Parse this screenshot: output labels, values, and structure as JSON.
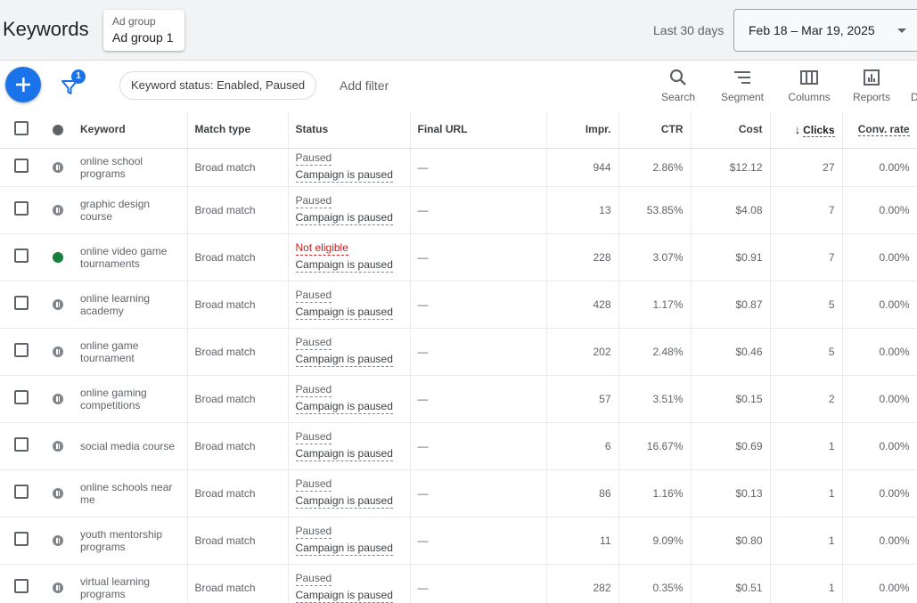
{
  "header": {
    "title": "Keywords",
    "ad_group_label": "Ad group",
    "ad_group_value": "Ad group 1",
    "range_label": "Last 30 days",
    "date_range": "Feb 18 – Mar 19, 2025"
  },
  "toolbar": {
    "filter_badge": "1",
    "filter_chip": "Keyword status: Enabled, Paused",
    "add_filter": "Add filter",
    "tools": [
      "Search",
      "Segment",
      "Columns",
      "Reports",
      "D"
    ]
  },
  "table": {
    "columns": {
      "keyword": "Keyword",
      "match_type": "Match type",
      "status": "Status",
      "final_url": "Final URL",
      "impr": "Impr.",
      "ctr": "CTR",
      "cost": "Cost",
      "clicks": "Clicks",
      "conv_rate": "Conv. rate"
    },
    "rows": [
      {
        "keyword": "online school programs",
        "state": "paused",
        "match": "Broad match",
        "status1": "Paused",
        "status2": "Campaign is paused",
        "url": "—",
        "impr": "944",
        "ctr": "2.86%",
        "cost": "$12.12",
        "clicks": "27",
        "conv": "0.00%"
      },
      {
        "keyword": "graphic design course",
        "state": "paused",
        "match": "Broad match",
        "status1": "Paused",
        "status2": "Campaign is paused",
        "url": "—",
        "impr": "13",
        "ctr": "53.85%",
        "cost": "$4.08",
        "clicks": "7",
        "conv": "0.00%"
      },
      {
        "keyword": "online video game tournaments",
        "state": "enabled",
        "match": "Broad match",
        "status1": "Not eligible",
        "status2": "Campaign is paused",
        "url": "—",
        "impr": "228",
        "ctr": "3.07%",
        "cost": "$0.91",
        "clicks": "7",
        "conv": "0.00%"
      },
      {
        "keyword": "online learning academy",
        "state": "paused",
        "match": "Broad match",
        "status1": "Paused",
        "status2": "Campaign is paused",
        "url": "—",
        "impr": "428",
        "ctr": "1.17%",
        "cost": "$0.87",
        "clicks": "5",
        "conv": "0.00%"
      },
      {
        "keyword": "online game tournament",
        "state": "paused",
        "match": "Broad match",
        "status1": "Paused",
        "status2": "Campaign is paused",
        "url": "—",
        "impr": "202",
        "ctr": "2.48%",
        "cost": "$0.46",
        "clicks": "5",
        "conv": "0.00%"
      },
      {
        "keyword": "online gaming competitions",
        "state": "paused",
        "match": "Broad match",
        "status1": "Paused",
        "status2": "Campaign is paused",
        "url": "—",
        "impr": "57",
        "ctr": "3.51%",
        "cost": "$0.15",
        "clicks": "2",
        "conv": "0.00%"
      },
      {
        "keyword": "social media course",
        "state": "paused",
        "match": "Broad match",
        "status1": "Paused",
        "status2": "Campaign is paused",
        "url": "—",
        "impr": "6",
        "ctr": "16.67%",
        "cost": "$0.69",
        "clicks": "1",
        "conv": "0.00%"
      },
      {
        "keyword": "online schools near me",
        "state": "paused",
        "match": "Broad match",
        "status1": "Paused",
        "status2": "Campaign is paused",
        "url": "—",
        "impr": "86",
        "ctr": "1.16%",
        "cost": "$0.13",
        "clicks": "1",
        "conv": "0.00%"
      },
      {
        "keyword": "youth mentorship programs",
        "state": "paused",
        "match": "Broad match",
        "status1": "Paused",
        "status2": "Campaign is paused",
        "url": "—",
        "impr": "11",
        "ctr": "9.09%",
        "cost": "$0.80",
        "clicks": "1",
        "conv": "0.00%"
      },
      {
        "keyword": "virtual learning programs",
        "state": "paused",
        "match": "Broad match",
        "status1": "Paused",
        "status2": "Campaign is paused",
        "url": "—",
        "impr": "282",
        "ctr": "0.35%",
        "cost": "$0.51",
        "clicks": "1",
        "conv": "0.00%"
      }
    ]
  },
  "colors": {
    "accent": "#1a73e8",
    "enabled": "#188038",
    "not_eligible": "#c5221f",
    "paused": "#80868b"
  }
}
